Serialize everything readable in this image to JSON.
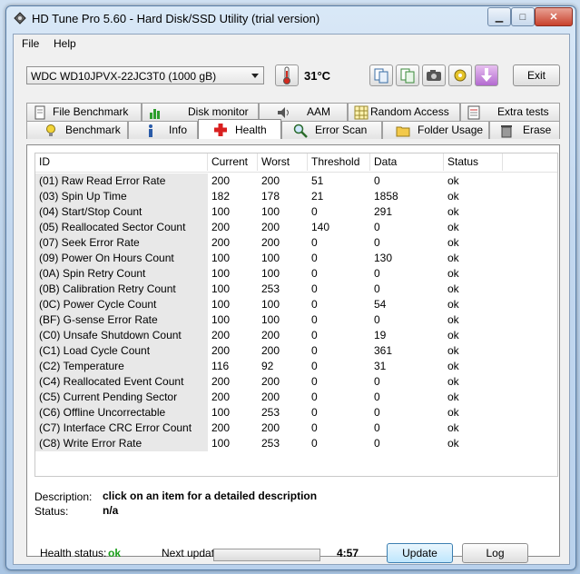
{
  "window": {
    "title": "HD Tune Pro 5.60 - Hard Disk/SSD Utility (trial version)"
  },
  "menu": {
    "file": "File",
    "help": "Help"
  },
  "toolbar": {
    "drive": "WDC WD10JPVX-22JC3T0 (1000 gB)",
    "temperature": "31°C",
    "exit": "Exit"
  },
  "tabs_top": [
    {
      "label": "File Benchmark"
    },
    {
      "label": "Disk monitor"
    },
    {
      "label": "AAM"
    },
    {
      "label": "Random Access"
    },
    {
      "label": "Extra tests"
    }
  ],
  "tabs_bottom": [
    {
      "label": "Benchmark"
    },
    {
      "label": "Info"
    },
    {
      "label": "Health"
    },
    {
      "label": "Error Scan"
    },
    {
      "label": "Folder Usage"
    },
    {
      "label": "Erase"
    }
  ],
  "columns": {
    "id": "ID",
    "current": "Current",
    "worst": "Worst",
    "threshold": "Threshold",
    "data": "Data",
    "status": "Status"
  },
  "rows": [
    {
      "id": "(01) Raw Read Error Rate",
      "current": "200",
      "worst": "200",
      "threshold": "51",
      "data": "0",
      "status": "ok"
    },
    {
      "id": "(03) Spin Up Time",
      "current": "182",
      "worst": "178",
      "threshold": "21",
      "data": "1858",
      "status": "ok"
    },
    {
      "id": "(04) Start/Stop Count",
      "current": "100",
      "worst": "100",
      "threshold": "0",
      "data": "291",
      "status": "ok"
    },
    {
      "id": "(05) Reallocated Sector Count",
      "current": "200",
      "worst": "200",
      "threshold": "140",
      "data": "0",
      "status": "ok"
    },
    {
      "id": "(07) Seek Error Rate",
      "current": "200",
      "worst": "200",
      "threshold": "0",
      "data": "0",
      "status": "ok"
    },
    {
      "id": "(09) Power On Hours Count",
      "current": "100",
      "worst": "100",
      "threshold": "0",
      "data": "130",
      "status": "ok"
    },
    {
      "id": "(0A) Spin Retry Count",
      "current": "100",
      "worst": "100",
      "threshold": "0",
      "data": "0",
      "status": "ok"
    },
    {
      "id": "(0B) Calibration Retry Count",
      "current": "100",
      "worst": "253",
      "threshold": "0",
      "data": "0",
      "status": "ok"
    },
    {
      "id": "(0C) Power Cycle Count",
      "current": "100",
      "worst": "100",
      "threshold": "0",
      "data": "54",
      "status": "ok"
    },
    {
      "id": "(BF) G-sense Error Rate",
      "current": "100",
      "worst": "100",
      "threshold": "0",
      "data": "0",
      "status": "ok"
    },
    {
      "id": "(C0) Unsafe Shutdown Count",
      "current": "200",
      "worst": "200",
      "threshold": "0",
      "data": "19",
      "status": "ok"
    },
    {
      "id": "(C1) Load Cycle Count",
      "current": "200",
      "worst": "200",
      "threshold": "0",
      "data": "361",
      "status": "ok"
    },
    {
      "id": "(C2) Temperature",
      "current": "116",
      "worst": "92",
      "threshold": "0",
      "data": "31",
      "status": "ok"
    },
    {
      "id": "(C4) Reallocated Event Count",
      "current": "200",
      "worst": "200",
      "threshold": "0",
      "data": "0",
      "status": "ok"
    },
    {
      "id": "(C5) Current Pending Sector",
      "current": "200",
      "worst": "200",
      "threshold": "0",
      "data": "0",
      "status": "ok"
    },
    {
      "id": "(C6) Offline Uncorrectable",
      "current": "100",
      "worst": "253",
      "threshold": "0",
      "data": "0",
      "status": "ok"
    },
    {
      "id": "(C7) Interface CRC Error Count",
      "current": "200",
      "worst": "200",
      "threshold": "0",
      "data": "0",
      "status": "ok"
    },
    {
      "id": "(C8) Write Error Rate",
      "current": "100",
      "worst": "253",
      "threshold": "0",
      "data": "0",
      "status": "ok"
    }
  ],
  "details": {
    "description_label": "Description:",
    "description_value": "click on an item for a detailed description",
    "status_label": "Status:",
    "status_value": "n/a"
  },
  "footer": {
    "health_label": "Health status:",
    "health_value": "ok",
    "next_update_label": "Next update:",
    "countdown": "4:57",
    "update_progress": 0.0,
    "update_button": "Update",
    "log_button": "Log"
  },
  "colors": {
    "ok_green": "#1a9e1a",
    "temp_red": "#d22a1f",
    "accent": "#3c7fb1"
  }
}
